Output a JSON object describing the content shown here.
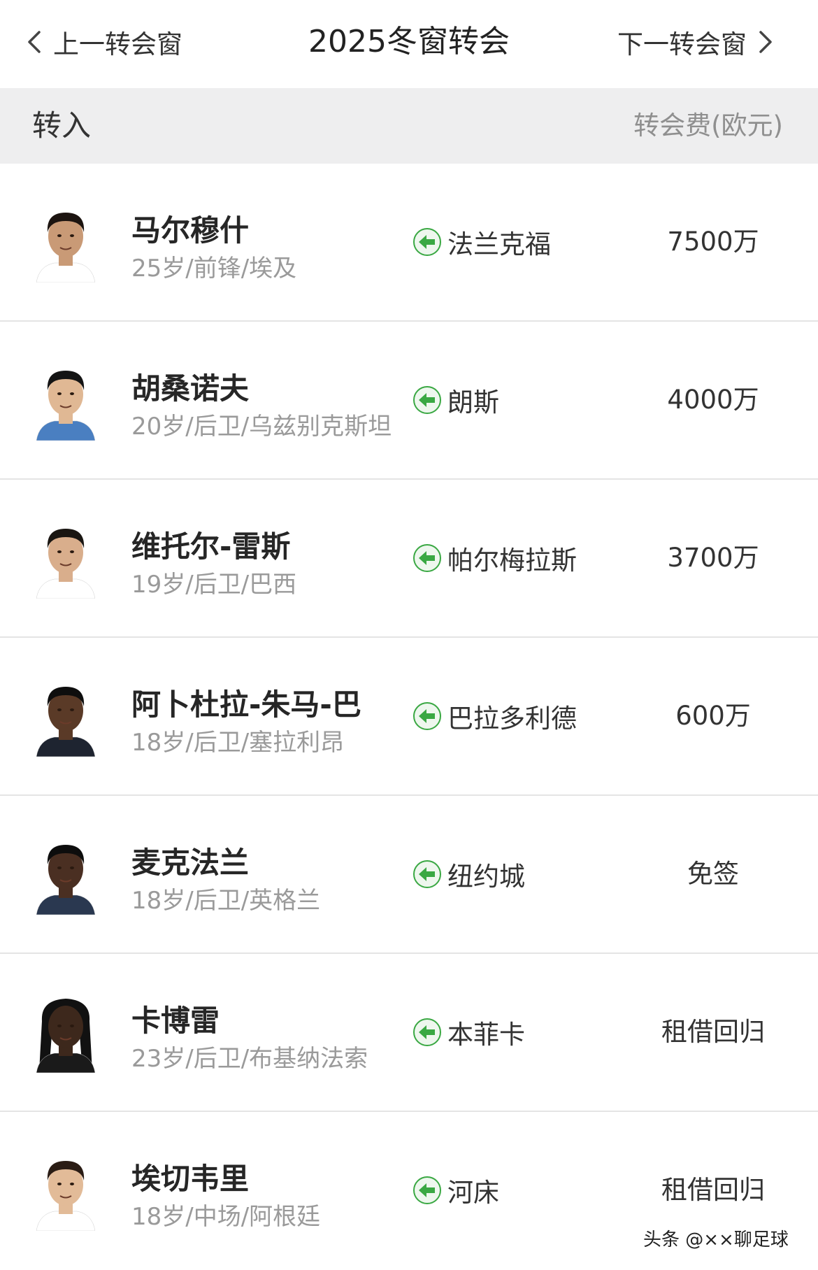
{
  "header": {
    "prev_label": "上一转会窗",
    "title": "2025冬窗转会",
    "next_label": "下一转会窗"
  },
  "section": {
    "title": "转入",
    "fee_header": "转会费(欧元)"
  },
  "colors": {
    "arrow_green": "#3aa843",
    "section_bg": "#eeeeef",
    "muted_text": "#9a9a9a"
  },
  "players": [
    {
      "name": "马尔穆什",
      "info": "25岁/前锋/埃及",
      "club": "法兰克福",
      "fee": "7500万"
    },
    {
      "name": "胡桑诺夫",
      "info": "20岁/后卫/乌兹别克斯坦",
      "club": "朗斯",
      "fee": "4000万"
    },
    {
      "name": "维托尔-雷斯",
      "info": "19岁/后卫/巴西",
      "club": "帕尔梅拉斯",
      "fee": "3700万"
    },
    {
      "name": "阿卜杜拉-朱马-巴",
      "info": "18岁/后卫/塞拉利昂",
      "club": "巴拉多利德",
      "fee": "600万"
    },
    {
      "name": "麦克法兰",
      "info": "18岁/后卫/英格兰",
      "club": "纽约城",
      "fee": "免签"
    },
    {
      "name": "卡博雷",
      "info": "23岁/后卫/布基纳法索",
      "club": "本菲卡",
      "fee": "租借回归"
    },
    {
      "name": "埃切韦里",
      "info": "18岁/中场/阿根廷",
      "club": "河床",
      "fee": "租借回归"
    }
  ],
  "watermark": "头条 @××聊足球"
}
